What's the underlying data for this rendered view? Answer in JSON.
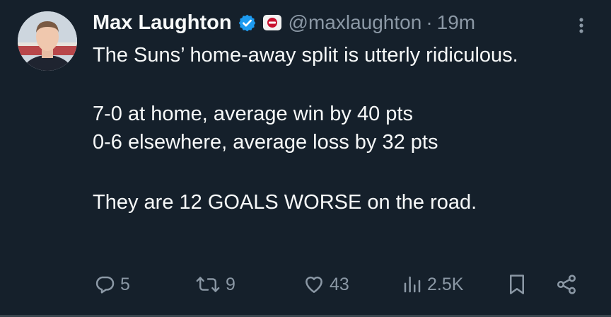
{
  "author": {
    "name": "Max Laughton",
    "handle": "@maxlaughton",
    "time": "19m",
    "separator": "·"
  },
  "tweet": {
    "lines": [
      "The Suns’ home-away split is utterly ridiculous.",
      "7-0 at home, average win by 40 pts",
      "0-6 elsewhere, average loss by 32 pts",
      "They are 12 GOALS WORSE on the road."
    ]
  },
  "actions": {
    "replies": "5",
    "retweets": "9",
    "likes": "43",
    "views": "2.5K"
  },
  "colors": {
    "background": "#15202b",
    "text": "#f7f9f9",
    "muted": "#8b98a5",
    "verified": "#1d9bf0"
  },
  "icons": {
    "verified": "verified-badge-icon",
    "affiliation": "fox-sports-affiliation-icon",
    "more": "more-options-icon",
    "reply": "reply-icon",
    "retweet": "retweet-icon",
    "like": "heart-icon",
    "views": "views-icon",
    "bookmark": "bookmark-icon",
    "share": "share-icon"
  }
}
